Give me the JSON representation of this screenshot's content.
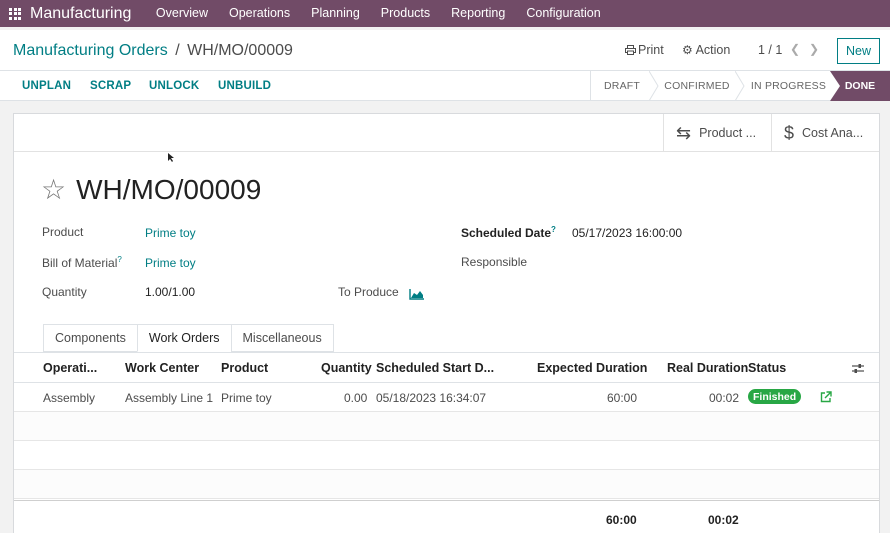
{
  "navbar": {
    "app_name": "Manufacturing",
    "menu": [
      "Overview",
      "Operations",
      "Planning",
      "Products",
      "Reporting",
      "Configuration"
    ],
    "apps_icon": "apps-grid-icon",
    "color": "#714B67"
  },
  "control": {
    "breadcrumb_parent": "Manufacturing Orders",
    "breadcrumb_sep": "/",
    "breadcrumb_current": "WH/MO/00009",
    "print_label": "Print",
    "action_label": "Action",
    "pager": "1 / 1",
    "new_label": "New"
  },
  "actions": {
    "unplan": "UNPLAN",
    "scrap": "SCRAP",
    "unlock": "UNLOCK",
    "unbuild": "UNBUILD"
  },
  "statusbar": {
    "steps": [
      "DRAFT",
      "CONFIRMED",
      "IN PROGRESS",
      "DONE"
    ],
    "current": "DONE"
  },
  "smart_buttons": {
    "product": "Product ...",
    "cost": "Cost Ana..."
  },
  "record": {
    "title": "WH/MO/00009",
    "product_label": "Product",
    "product_value": "Prime toy",
    "bom_label": "Bill of Material",
    "bom_value": "Prime toy",
    "quantity_label": "Quantity",
    "quantity_value": "1.00/1.00",
    "to_produce_label": "To Produce",
    "scheduled_date_label": "Scheduled Date",
    "scheduled_date_value": "05/17/2023 16:00:00",
    "responsible_label": "Responsible",
    "help_mark": "?"
  },
  "tabs": [
    "Components",
    "Work Orders",
    "Miscellaneous"
  ],
  "active_tab": "Work Orders",
  "table": {
    "headers": [
      "Operati...",
      "Work Center",
      "Product",
      "Quantity",
      "Scheduled Start D...",
      "Expected Duration",
      "Real Duration",
      "Status"
    ],
    "rows": [
      {
        "operation": "Assembly",
        "work_center": "Assembly Line 1",
        "product": "Prime toy",
        "quantity": "0.00",
        "scheduled_start": "05/18/2023 16:34:07",
        "expected_duration": "60:00",
        "real_duration": "00:02",
        "status": "Finished"
      }
    ],
    "totals": {
      "expected_duration": "60:00",
      "real_duration": "00:02"
    },
    "status_color": "#28a745"
  },
  "accent": "#017e84"
}
